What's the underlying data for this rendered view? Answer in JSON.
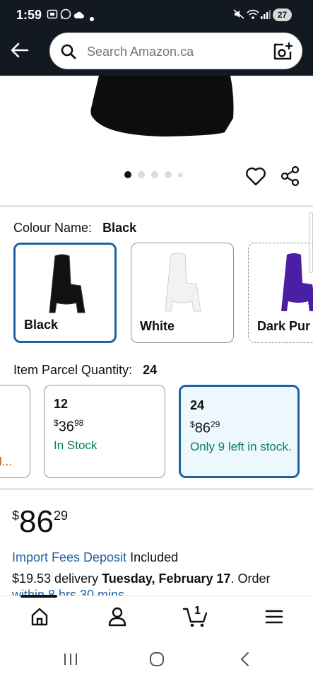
{
  "status_bar": {
    "time": "1:59",
    "battery": "27"
  },
  "search": {
    "placeholder": "Search Amazon.ca"
  },
  "gallery": {
    "image_count": 5,
    "active_index": 0
  },
  "colour": {
    "label": "Colour Name:",
    "selected": "Black",
    "options": [
      {
        "name": "Black",
        "chair_color": "#111111"
      },
      {
        "name": "White",
        "chair_color": "#f2f2f2"
      },
      {
        "name": "Dark Pur",
        "chair_color": "#4b1fa3"
      }
    ]
  },
  "quantity": {
    "label": "Item Parcel Quantity:",
    "selected": "24",
    "partial_status": "l...",
    "options": [
      {
        "qty": "12",
        "price_whole": "36",
        "price_frac": "98",
        "currency": "$",
        "status": "In Stock"
      },
      {
        "qty": "24",
        "price_whole": "86",
        "price_frac": "29",
        "currency": "$",
        "status": "Only 9 left in stock."
      }
    ]
  },
  "price": {
    "currency": "$",
    "whole": "86",
    "fraction": "29"
  },
  "import_fees": {
    "link": "Import Fees Deposit",
    "text": "Included"
  },
  "delivery": {
    "price": "$19.53 delivery",
    "date": "Tuesday, February 17",
    "suffix": ". Order",
    "countdown": "within 8 hrs 30 mins"
  },
  "bottom_nav": {
    "cart_count": "1"
  },
  "colors": {
    "header_bg": "#131921",
    "selected_border": "#2162a1",
    "stock_green": "#067d62",
    "link_blue": "#2162a1"
  }
}
